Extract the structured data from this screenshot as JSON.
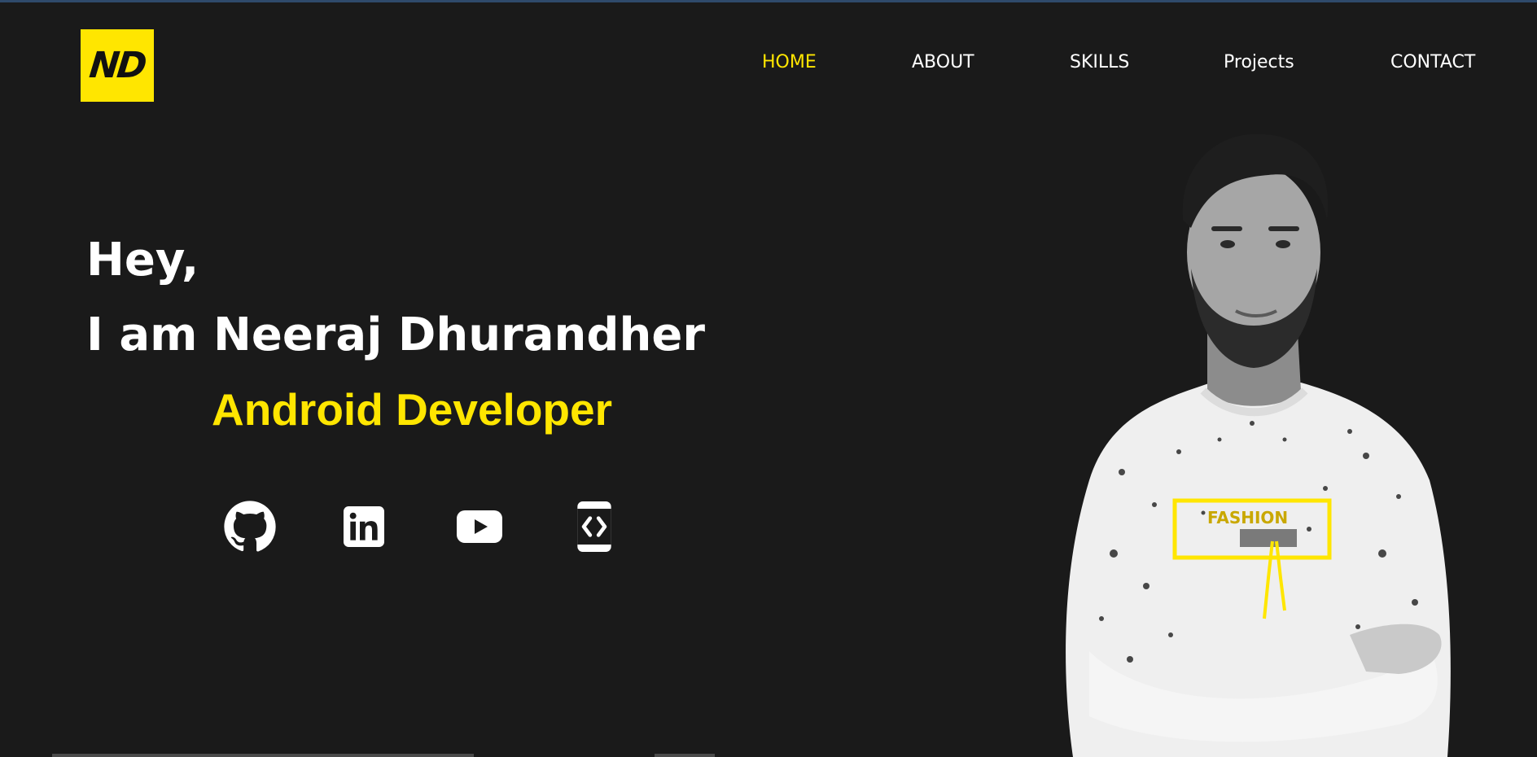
{
  "logo": {
    "text": "ND"
  },
  "nav": {
    "items": [
      {
        "label": "HOME",
        "active": true
      },
      {
        "label": "ABOUT",
        "active": false
      },
      {
        "label": "SKILLS",
        "active": false
      },
      {
        "label": "Projects",
        "active": false
      },
      {
        "label": "CONTACT",
        "active": false
      }
    ]
  },
  "hero": {
    "greeting": "Hey,",
    "name_line": "I am Neeraj Dhurandher",
    "role": "Android Developer"
  },
  "social": [
    {
      "icon": "github-icon"
    },
    {
      "icon": "linkedin-icon"
    },
    {
      "icon": "youtube-icon"
    },
    {
      "icon": "code-device-icon"
    }
  ],
  "colors": {
    "background": "#1a1a1a",
    "accent": "#ffe600",
    "text": "#ffffff"
  }
}
